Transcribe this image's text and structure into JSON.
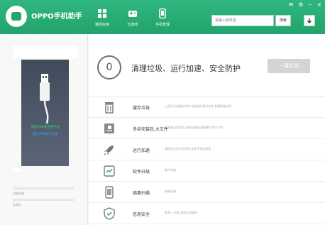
{
  "app": {
    "title": "OPPO手机助手"
  },
  "nav": [
    {
      "label": "我的应用",
      "icon": "grid-icon"
    },
    {
      "label": "玩游戏",
      "icon": "gamepad-icon"
    },
    {
      "label": "手机管理",
      "icon": "phone-icon"
    }
  ],
  "window_controls": {
    "mail": "✉",
    "settings": "⚙",
    "minimize": "–",
    "close": "×"
  },
  "search": {
    "placeholder": "请输入软件名",
    "button": "搜索"
  },
  "download_icon": "download-icon",
  "device": {
    "hint_line1": "请用USB线连接手机",
    "hint_line2": "通过手机助手连接",
    "internal_storage_label": "内部存储",
    "sd_storage_label": "存储卡"
  },
  "cleanup": {
    "score": "0",
    "headline": "清理垃圾、运行加速、安全防护",
    "button": "一键检测"
  },
  "items": [
    {
      "title": "缓存垃圾",
      "desc": "上网产生的缓存文件,系统运行临时文件,卸载残留文件",
      "icon": "trash-icon"
    },
    {
      "title": "多余安装包,大文件",
      "desc": "已安装过的应用,安装包残留,视频图片等大文件",
      "icon": "package-icon"
    },
    {
      "title": "运行加速",
      "desc": "清理后台运行的程序,优化手机的速度",
      "icon": "rocket-icon"
    },
    {
      "title": "软件升级",
      "desc": "软件升级",
      "icon": "upgrade-icon"
    },
    {
      "title": "病毒扫描",
      "desc": "病毒扫描",
      "icon": "scan-icon"
    },
    {
      "title": "信息安全",
      "desc": "联系人,短信,通话记录备份",
      "icon": "shield-icon"
    }
  ],
  "colors": {
    "brand_green": "#22a46c",
    "button_gray": "#d4d4d4"
  }
}
